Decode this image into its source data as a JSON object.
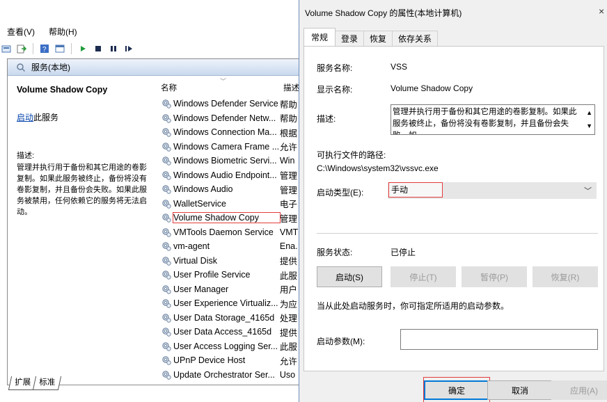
{
  "console": {
    "menu": [
      "查看(V)",
      "帮助(H)"
    ],
    "toolbar_icons": [
      "properties-icon",
      "export-icon",
      "help-icon",
      "view-icon",
      "play-icon",
      "stop-icon",
      "pause-icon",
      "resume-icon"
    ],
    "scope_title": "服务(本地)",
    "detail": {
      "title": "Volume Shadow Copy",
      "start_link": "启动",
      "start_suffix": "此服务",
      "desc_label": "描述:",
      "desc_text": "管理并执行用于备份和其它用途的卷影复制。如果此服务被终止，备份将没有卷影复制，并且备份会失败。如果此服务被禁用，任何依赖它的服务将无法启动。"
    },
    "columns": {
      "name": "名称",
      "desc": "描述"
    },
    "services": [
      {
        "name": "Windows Defender Service",
        "desc": "帮助"
      },
      {
        "name": "Windows Defender Netw...",
        "desc": "帮助"
      },
      {
        "name": "Windows Connection Ma...",
        "desc": "根据"
      },
      {
        "name": "Windows Camera Frame ...",
        "desc": "允许"
      },
      {
        "name": "Windows Biometric Servi...",
        "desc": "Win"
      },
      {
        "name": "Windows Audio Endpoint...",
        "desc": "管理"
      },
      {
        "name": "Windows Audio",
        "desc": "管理"
      },
      {
        "name": "WalletService",
        "desc": "电子"
      },
      {
        "name": "Volume Shadow Copy",
        "desc": "管理",
        "selected": true
      },
      {
        "name": "VMTools Daemon Service",
        "desc": "VMT"
      },
      {
        "name": "vm-agent",
        "desc": "Ena."
      },
      {
        "name": "Virtual Disk",
        "desc": "提供"
      },
      {
        "name": "User Profile Service",
        "desc": "此服"
      },
      {
        "name": "User Manager",
        "desc": "用户"
      },
      {
        "name": "User Experience Virtualiz...",
        "desc": "为应"
      },
      {
        "name": "User Data Storage_4165d",
        "desc": "处理"
      },
      {
        "name": "User Data Access_4165d",
        "desc": "提供"
      },
      {
        "name": "User Access Logging Ser...",
        "desc": "此服"
      },
      {
        "name": "UPnP Device Host",
        "desc": "允许"
      },
      {
        "name": "Update Orchestrator Ser...",
        "desc": "Uso"
      }
    ],
    "view_tabs": [
      "扩展",
      "标准"
    ]
  },
  "dialog": {
    "title": "Volume Shadow Copy 的属性(本地计算机)",
    "close_glyph": "×",
    "tabs": [
      "常规",
      "登录",
      "恢复",
      "依存关系"
    ],
    "service_name_label": "服务名称:",
    "service_name": "VSS",
    "display_name_label": "显示名称:",
    "display_name": "Volume Shadow Copy",
    "description_label": "描述:",
    "description": "管理并执行用于备份和其它用途的卷影复制。如果此服务被终止，备份将没有卷影复制，并且备份会失败。如",
    "path_label": "可执行文件的路径:",
    "path": "C:\\Windows\\system32\\vssvc.exe",
    "startup_type_label": "启动类型(E):",
    "startup_type": "手动",
    "status_label": "服务状态:",
    "status": "已停止",
    "buttons": {
      "start": "启动(S)",
      "stop": "停止(T)",
      "pause": "暂停(P)",
      "resume": "恢复(R)"
    },
    "hint": "当从此处启动服务时，你可指定所适用的启动参数。",
    "params_label": "启动参数(M):",
    "params_value": "",
    "footer": {
      "ok": "确定",
      "cancel": "取消",
      "apply": "应用(A)"
    }
  },
  "colors": {
    "highlight": "#e43b3b",
    "focus": "#0078d7",
    "header_gradient": "#c9d9ee"
  }
}
